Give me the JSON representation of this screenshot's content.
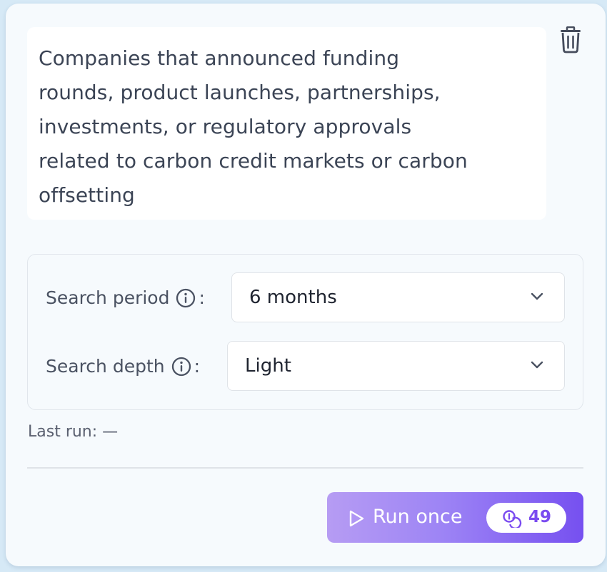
{
  "prompt": {
    "text": "Companies that announced funding rounds, product launches, partnerships, investments, or regulatory approvals related to carbon credit markets or carbon offsetting",
    "lines": [
      "Companies that announced funding",
      "rounds, product launches, partnerships,",
      "investments, or regulatory approvals",
      "related to carbon credit markets or carbon",
      "offsetting"
    ]
  },
  "settings": {
    "period_label": "Search period",
    "period_value": "6 months",
    "depth_label": "Search depth",
    "depth_value": "Light",
    "colon": ":"
  },
  "last_run": "Last run: —",
  "run_button": {
    "label": "Run once",
    "credits": "49"
  },
  "icons": {
    "delete": "trash-icon",
    "info": "info-icon",
    "dropdown": "chevron-down-icon",
    "run": "play-icon",
    "credits": "coins-icon"
  },
  "colors": {
    "accent": "#7650f0",
    "accent_light": "#b69cf3",
    "text": "#3b4455"
  }
}
